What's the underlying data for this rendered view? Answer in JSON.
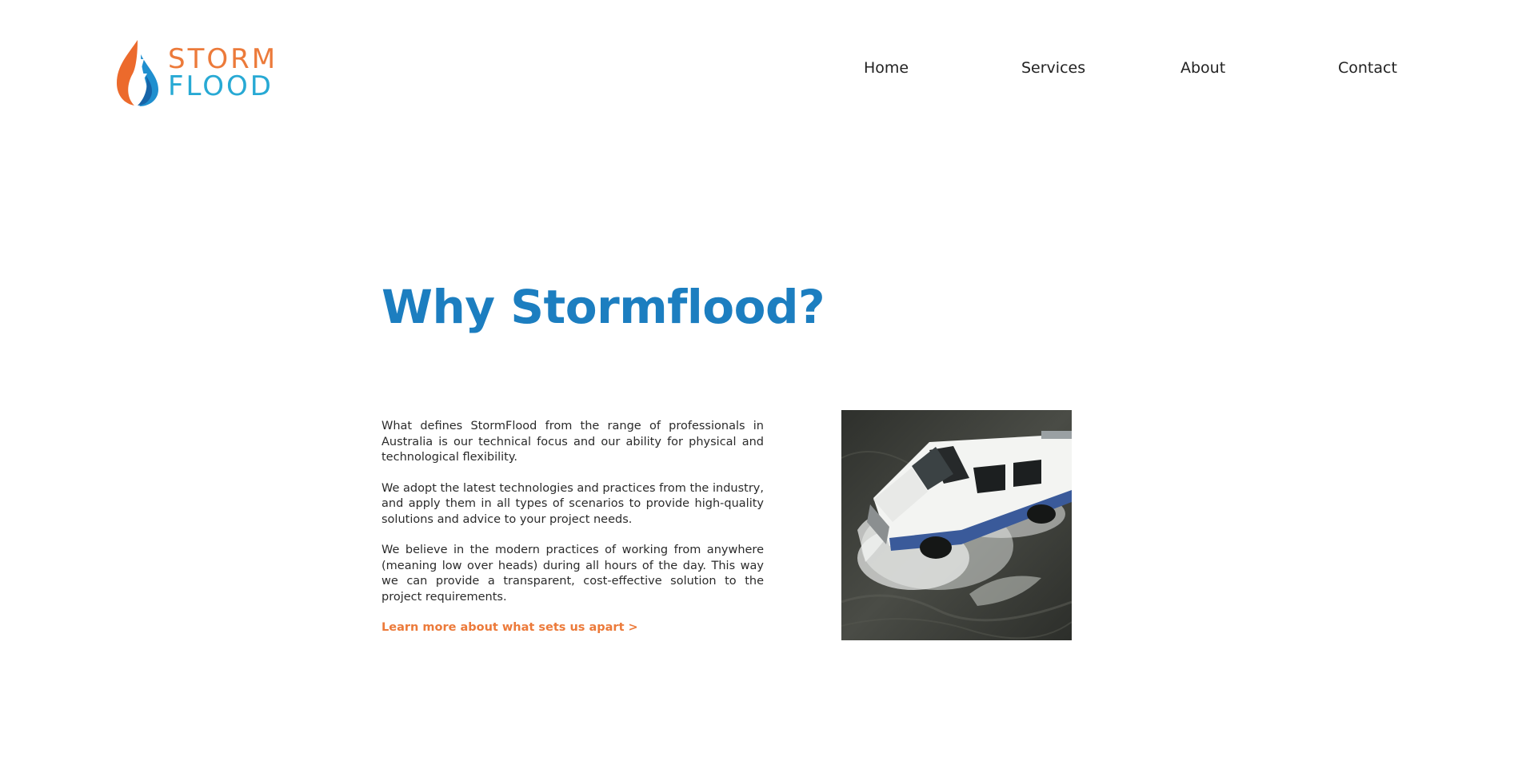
{
  "brand": {
    "name_line1": "STORM",
    "name_line2": "FLOOD",
    "colors": {
      "orange": "#ec7a3a",
      "blue": "#27a9d4",
      "heading_blue": "#1c7ec0"
    }
  },
  "nav": {
    "items": [
      {
        "label": "Home"
      },
      {
        "label": "Services"
      },
      {
        "label": "About"
      },
      {
        "label": "Contact"
      }
    ]
  },
  "main": {
    "heading": "Why Stormflood?",
    "paragraphs": [
      "What defines StormFlood from the range of professionals in Australia is our technical focus and our ability for physical and technological flexibility.",
      "We adopt the latest technologies and practices from the industry, and apply them in all types of scenarios to provide high-quality solutions and advice to your project needs.",
      "We believe in the modern practices of working from anywhere (meaning low over heads) during all hours of the day. This way we can provide a transparent, cost-effective solution to the project requirements."
    ],
    "learn_more": "Learn more about what sets us apart >",
    "image": {
      "icon": "truck-in-flood-photo"
    }
  }
}
